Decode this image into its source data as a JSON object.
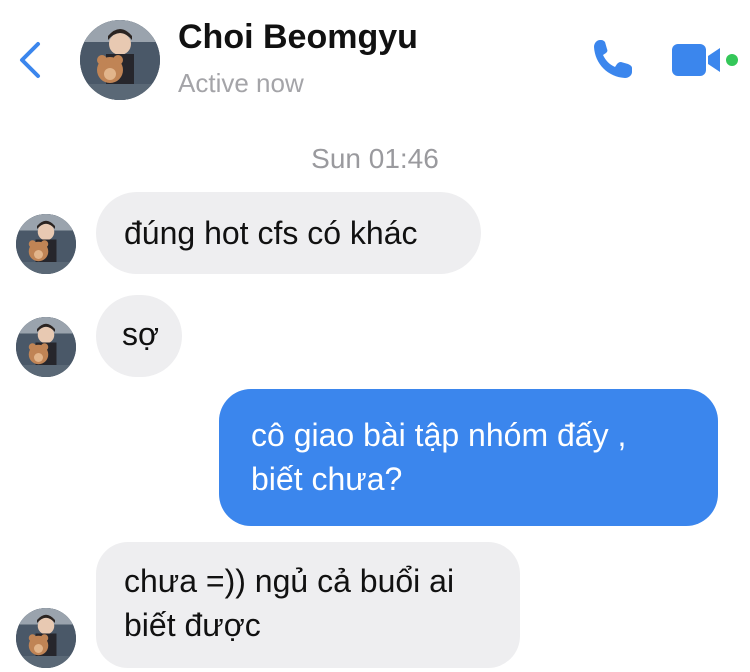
{
  "header": {
    "contact_name": "Choi Beomgyu",
    "status": "Active now",
    "accent_color": "#3b86ed",
    "online_color": "#34c759",
    "icons": [
      "chevron-left-icon",
      "phone-icon",
      "video-camera-icon"
    ]
  },
  "conversation": {
    "timestamp": "Sun 01:46",
    "messages": [
      {
        "sender": "contact",
        "text": "đúng hot cfs có khác"
      },
      {
        "sender": "contact",
        "text": "sợ"
      },
      {
        "sender": "me",
        "lines": [
          "cô giao bài tập nhóm đấy ,",
          "biết chưa?"
        ]
      },
      {
        "sender": "contact",
        "lines": [
          "chưa =)) ngủ cả buổi ai",
          "biết được"
        ]
      }
    ]
  }
}
